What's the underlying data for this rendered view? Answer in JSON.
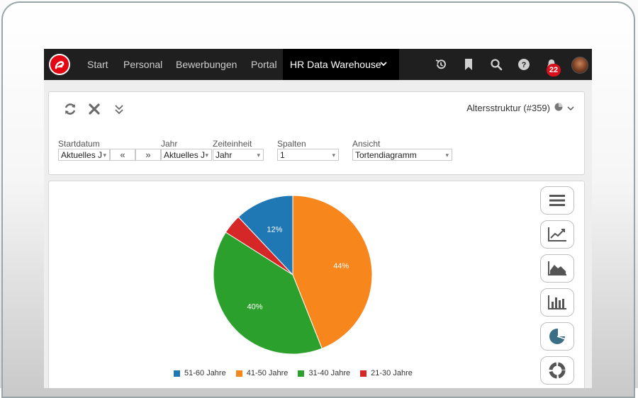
{
  "nav": {
    "items": [
      "Start",
      "Personal",
      "Bewerbungen",
      "Portal"
    ],
    "active": "HR Data Warehouse",
    "notification_count": "22"
  },
  "toolbar": {
    "report_title": "Altersstruktur (#359)"
  },
  "filters": {
    "startdatum": {
      "label": "Startdatum",
      "value": "Aktuelles J"
    },
    "prev_label": "«",
    "next_label": "»",
    "jahr": {
      "label": "Jahr",
      "value": "Aktuelles J"
    },
    "zeiteinheit": {
      "label": "Zeiteinheit",
      "value": "Jahr"
    },
    "spalten": {
      "label": "Spalten",
      "value": "1"
    },
    "ansicht": {
      "label": "Ansicht",
      "value": "Tortendiagramm"
    }
  },
  "side_buttons": [
    "menu-icon",
    "line-chart-icon",
    "area-chart-icon",
    "bar-chart-icon",
    "pie-chart-icon",
    "donut-chart-icon"
  ],
  "chart_data": {
    "type": "pie",
    "title": "",
    "slices": [
      {
        "label": "41-50 Jahre",
        "value": 44,
        "display": "44%",
        "color": "#f7861c"
      },
      {
        "label": "31-40 Jahre",
        "value": 40,
        "display": "40%",
        "color": "#2ca02c"
      },
      {
        "label": "21-30 Jahre",
        "value": 4,
        "display": "",
        "color": "#d62728"
      },
      {
        "label": "51-60 Jahre",
        "value": 12,
        "display": "12%",
        "color": "#1f77b4"
      }
    ],
    "legend": [
      {
        "label": "51-60 Jahre",
        "color": "#1f77b4"
      },
      {
        "label": "41-50 Jahre",
        "color": "#f7861c"
      },
      {
        "label": "31-40 Jahre",
        "color": "#2ca02c"
      },
      {
        "label": "21-30 Jahre",
        "color": "#d62728"
      }
    ],
    "legend_position": "bottom"
  }
}
